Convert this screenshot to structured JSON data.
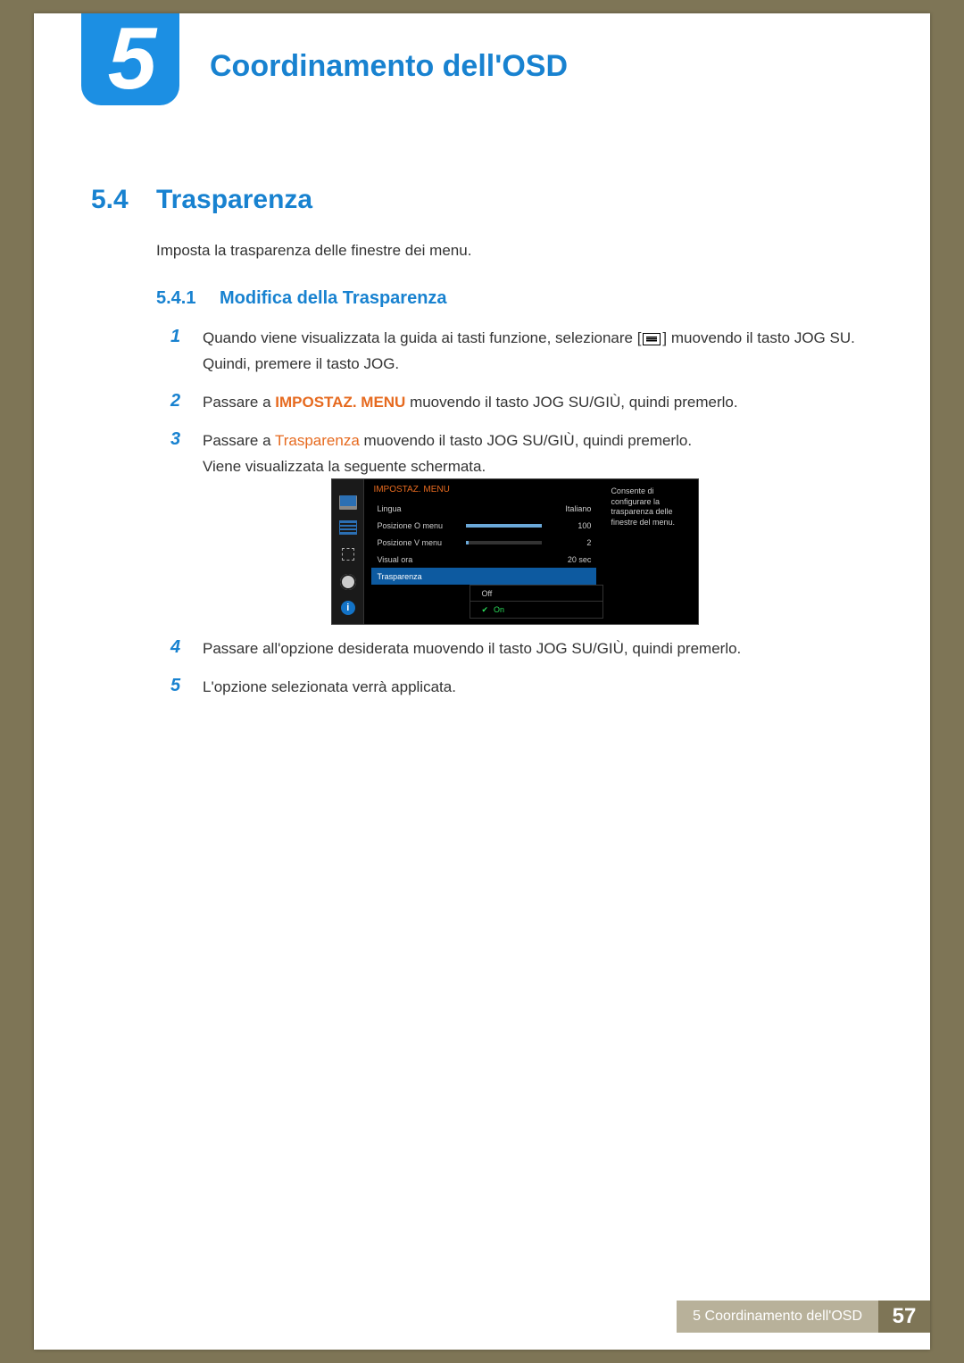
{
  "chapter": {
    "number": "5",
    "title": "Coordinamento dell'OSD"
  },
  "section": {
    "number": "5.4",
    "title": "Trasparenza"
  },
  "intro": "Imposta la trasparenza delle finestre dei menu.",
  "subsection": {
    "number": "5.4.1",
    "title": "Modifica della Trasparenza"
  },
  "steps": {
    "s1a": "Quando viene visualizzata la guida ai tasti funzione, selezionare [",
    "s1b": "] muovendo il tasto JOG SU. Quindi, premere il tasto JOG.",
    "s2a": "Passare a ",
    "s2b": "IMPOSTAZ. MENU",
    "s2c": " muovendo il tasto JOG SU/GIÙ, quindi premerlo.",
    "s3a": "Passare a ",
    "s3b": "Trasparenza",
    "s3c": " muovendo il tasto JOG SU/GIÙ, quindi premerlo.",
    "s3d": "Viene visualizzata la seguente schermata.",
    "s4": "Passare all'opzione desiderata muovendo il tasto JOG SU/GIÙ, quindi premerlo.",
    "s5": "L'opzione selezionata verrà applicata."
  },
  "num": {
    "1": "1",
    "2": "2",
    "3": "3",
    "4": "4",
    "5": "5"
  },
  "osd": {
    "header": "IMPOSTAZ. MENU",
    "rows": {
      "lingua": {
        "label": "Lingua",
        "value": "Italiano"
      },
      "posO": {
        "label": "Posizione O menu",
        "value": "100"
      },
      "posV": {
        "label": "Posizione V menu",
        "value": "2"
      },
      "visual": {
        "label": "Visual ora",
        "value": "20 sec"
      },
      "trasp": {
        "label": "Trasparenza"
      }
    },
    "options": {
      "off": "Off",
      "on": "On"
    },
    "desc": "Consente di configurare la trasparenza delle finestre del menu."
  },
  "footer": {
    "label": "5 Coordinamento dell'OSD",
    "page": "57"
  }
}
